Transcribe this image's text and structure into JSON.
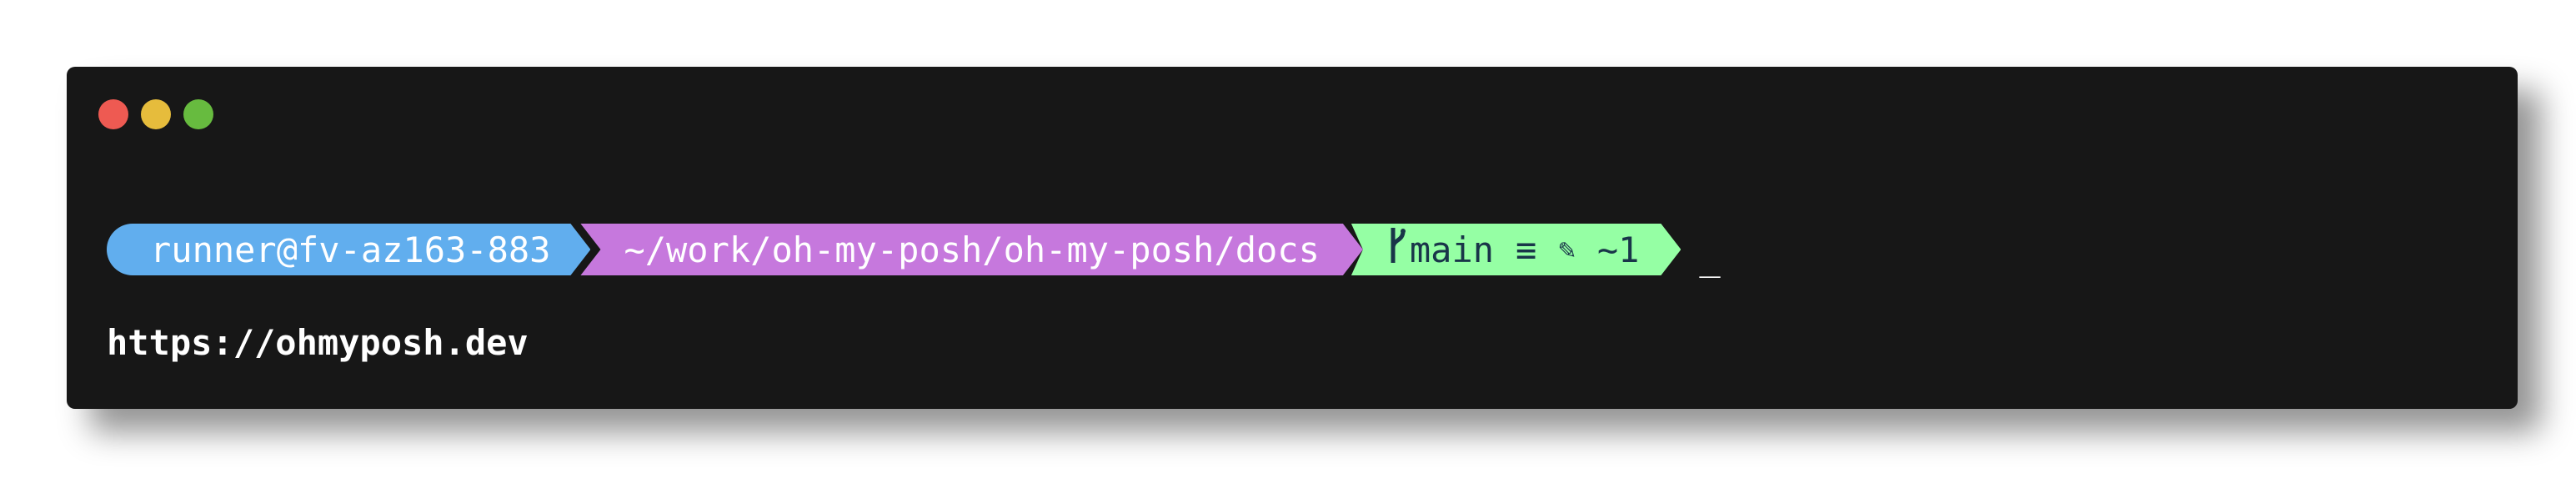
{
  "window": {
    "background": "#171717",
    "controls": [
      {
        "name": "close",
        "color": "#ee5a52"
      },
      {
        "name": "minimize",
        "color": "#e6bc3c"
      },
      {
        "name": "maximize",
        "color": "#67bb3f"
      }
    ]
  },
  "prompt": {
    "user_segment": {
      "text": "runner@fv-az163-883",
      "background": "#61aeee",
      "foreground": "#ffffff"
    },
    "path_segment": {
      "text": "~/work/oh-my-posh/oh-my-posh/docs",
      "background": "#c678dd",
      "foreground": "#ffffff"
    },
    "git_segment": {
      "icon": "git-branch-icon",
      "branch": "main",
      "status_symbol": "≡",
      "edit_icon": "✎",
      "changes": "~1",
      "background": "#95ffa4",
      "foreground": "#193549"
    },
    "cursor": "_"
  },
  "output": {
    "line": "https://ohmyposh.dev"
  }
}
